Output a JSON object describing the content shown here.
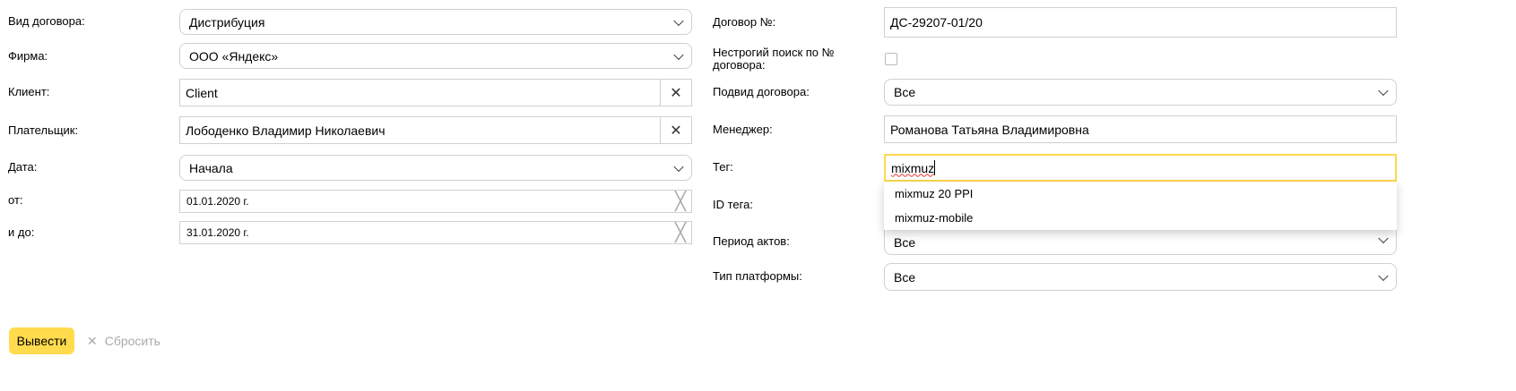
{
  "left": {
    "contract_type": {
      "label": "Вид договора:",
      "value": "Дистрибуция"
    },
    "firm": {
      "label": "Фирма:",
      "value": "ООО «Яндекс»"
    },
    "client": {
      "label": "Клиент:",
      "value": "Client"
    },
    "payer": {
      "label": "Плательщик:",
      "value": "Лободенко Владимир Николаевич"
    },
    "date": {
      "label": "Дата:",
      "value": "Начала"
    },
    "from": {
      "label": "от:",
      "value": "01.01.2020 г."
    },
    "to": {
      "label": "и до:",
      "value": "31.01.2020 г."
    }
  },
  "right": {
    "contract_no": {
      "label": "Договор №:",
      "value": "ДС-29207-01/20"
    },
    "fuzzy": {
      "label": "Нестрогий поиск по № договора:",
      "checked": false
    },
    "subtype": {
      "label": "Подвид договора:",
      "value": "Все"
    },
    "manager": {
      "label": "Менеджер:",
      "value": "Романова Татьяна Владимировна"
    },
    "tag": {
      "label": "Тег:",
      "value": "mixmuz",
      "suggestions": [
        "mixmuz 20 PPI",
        "mixmuz-mobile"
      ]
    },
    "tag_id": {
      "label": "ID тега:"
    },
    "acts_period": {
      "label": "Период актов:",
      "value": "Все"
    },
    "platform": {
      "label": "Тип платформы:",
      "value": "Все"
    }
  },
  "actions": {
    "submit": "Вывести",
    "reset": "Сбросить"
  },
  "colors": {
    "accent": "#ffdb4d",
    "focus": "#fed84d"
  }
}
